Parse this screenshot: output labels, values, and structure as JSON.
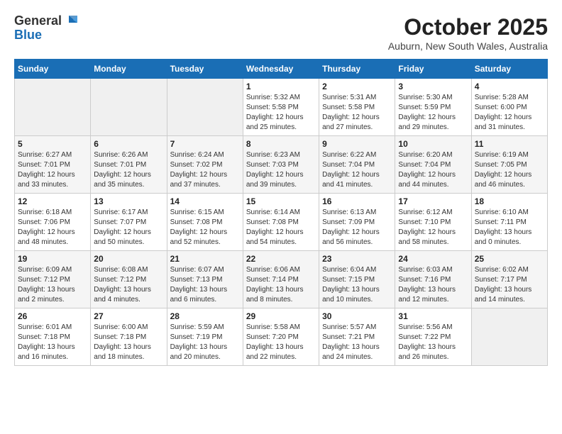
{
  "header": {
    "logo_general": "General",
    "logo_blue": "Blue",
    "month_title": "October 2025",
    "location": "Auburn, New South Wales, Australia"
  },
  "days_of_week": [
    "Sunday",
    "Monday",
    "Tuesday",
    "Wednesday",
    "Thursday",
    "Friday",
    "Saturday"
  ],
  "weeks": [
    [
      {
        "day": "",
        "info": ""
      },
      {
        "day": "",
        "info": ""
      },
      {
        "day": "",
        "info": ""
      },
      {
        "day": "1",
        "info": "Sunrise: 5:32 AM\nSunset: 5:58 PM\nDaylight: 12 hours\nand 25 minutes."
      },
      {
        "day": "2",
        "info": "Sunrise: 5:31 AM\nSunset: 5:58 PM\nDaylight: 12 hours\nand 27 minutes."
      },
      {
        "day": "3",
        "info": "Sunrise: 5:30 AM\nSunset: 5:59 PM\nDaylight: 12 hours\nand 29 minutes."
      },
      {
        "day": "4",
        "info": "Sunrise: 5:28 AM\nSunset: 6:00 PM\nDaylight: 12 hours\nand 31 minutes."
      }
    ],
    [
      {
        "day": "5",
        "info": "Sunrise: 6:27 AM\nSunset: 7:01 PM\nDaylight: 12 hours\nand 33 minutes."
      },
      {
        "day": "6",
        "info": "Sunrise: 6:26 AM\nSunset: 7:01 PM\nDaylight: 12 hours\nand 35 minutes."
      },
      {
        "day": "7",
        "info": "Sunrise: 6:24 AM\nSunset: 7:02 PM\nDaylight: 12 hours\nand 37 minutes."
      },
      {
        "day": "8",
        "info": "Sunrise: 6:23 AM\nSunset: 7:03 PM\nDaylight: 12 hours\nand 39 minutes."
      },
      {
        "day": "9",
        "info": "Sunrise: 6:22 AM\nSunset: 7:04 PM\nDaylight: 12 hours\nand 41 minutes."
      },
      {
        "day": "10",
        "info": "Sunrise: 6:20 AM\nSunset: 7:04 PM\nDaylight: 12 hours\nand 44 minutes."
      },
      {
        "day": "11",
        "info": "Sunrise: 6:19 AM\nSunset: 7:05 PM\nDaylight: 12 hours\nand 46 minutes."
      }
    ],
    [
      {
        "day": "12",
        "info": "Sunrise: 6:18 AM\nSunset: 7:06 PM\nDaylight: 12 hours\nand 48 minutes."
      },
      {
        "day": "13",
        "info": "Sunrise: 6:17 AM\nSunset: 7:07 PM\nDaylight: 12 hours\nand 50 minutes."
      },
      {
        "day": "14",
        "info": "Sunrise: 6:15 AM\nSunset: 7:08 PM\nDaylight: 12 hours\nand 52 minutes."
      },
      {
        "day": "15",
        "info": "Sunrise: 6:14 AM\nSunset: 7:08 PM\nDaylight: 12 hours\nand 54 minutes."
      },
      {
        "day": "16",
        "info": "Sunrise: 6:13 AM\nSunset: 7:09 PM\nDaylight: 12 hours\nand 56 minutes."
      },
      {
        "day": "17",
        "info": "Sunrise: 6:12 AM\nSunset: 7:10 PM\nDaylight: 12 hours\nand 58 minutes."
      },
      {
        "day": "18",
        "info": "Sunrise: 6:10 AM\nSunset: 7:11 PM\nDaylight: 13 hours\nand 0 minutes."
      }
    ],
    [
      {
        "day": "19",
        "info": "Sunrise: 6:09 AM\nSunset: 7:12 PM\nDaylight: 13 hours\nand 2 minutes."
      },
      {
        "day": "20",
        "info": "Sunrise: 6:08 AM\nSunset: 7:12 PM\nDaylight: 13 hours\nand 4 minutes."
      },
      {
        "day": "21",
        "info": "Sunrise: 6:07 AM\nSunset: 7:13 PM\nDaylight: 13 hours\nand 6 minutes."
      },
      {
        "day": "22",
        "info": "Sunrise: 6:06 AM\nSunset: 7:14 PM\nDaylight: 13 hours\nand 8 minutes."
      },
      {
        "day": "23",
        "info": "Sunrise: 6:04 AM\nSunset: 7:15 PM\nDaylight: 13 hours\nand 10 minutes."
      },
      {
        "day": "24",
        "info": "Sunrise: 6:03 AM\nSunset: 7:16 PM\nDaylight: 13 hours\nand 12 minutes."
      },
      {
        "day": "25",
        "info": "Sunrise: 6:02 AM\nSunset: 7:17 PM\nDaylight: 13 hours\nand 14 minutes."
      }
    ],
    [
      {
        "day": "26",
        "info": "Sunrise: 6:01 AM\nSunset: 7:18 PM\nDaylight: 13 hours\nand 16 minutes."
      },
      {
        "day": "27",
        "info": "Sunrise: 6:00 AM\nSunset: 7:18 PM\nDaylight: 13 hours\nand 18 minutes."
      },
      {
        "day": "28",
        "info": "Sunrise: 5:59 AM\nSunset: 7:19 PM\nDaylight: 13 hours\nand 20 minutes."
      },
      {
        "day": "29",
        "info": "Sunrise: 5:58 AM\nSunset: 7:20 PM\nDaylight: 13 hours\nand 22 minutes."
      },
      {
        "day": "30",
        "info": "Sunrise: 5:57 AM\nSunset: 7:21 PM\nDaylight: 13 hours\nand 24 minutes."
      },
      {
        "day": "31",
        "info": "Sunrise: 5:56 AM\nSunset: 7:22 PM\nDaylight: 13 hours\nand 26 minutes."
      },
      {
        "day": "",
        "info": ""
      }
    ]
  ]
}
